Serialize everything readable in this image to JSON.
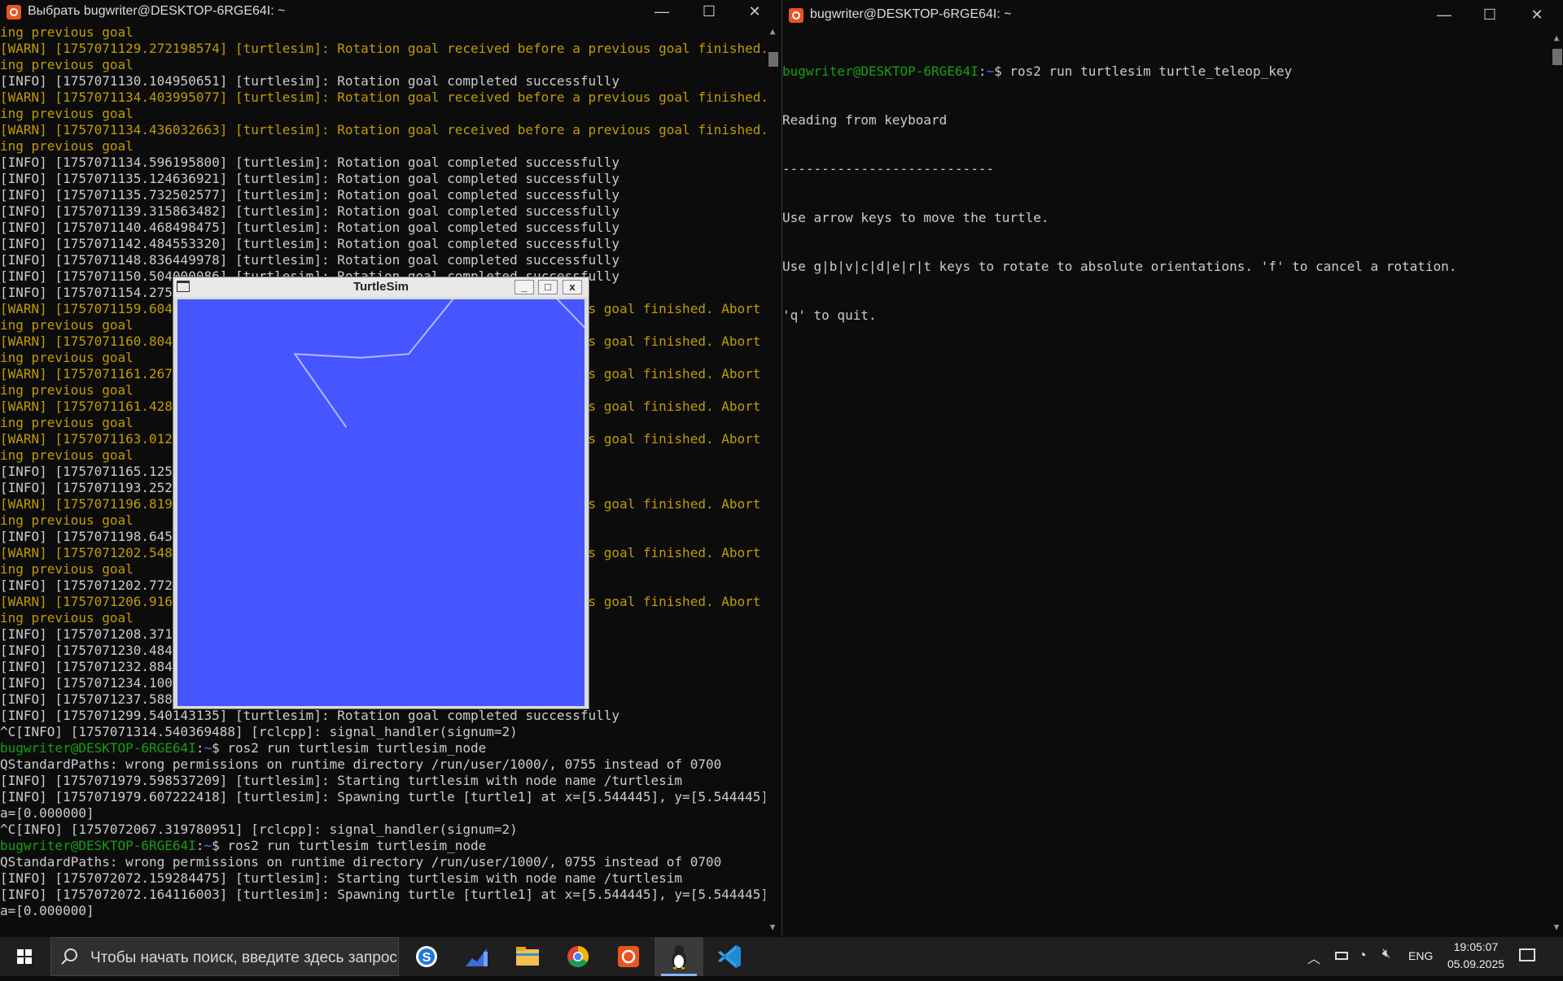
{
  "left_window": {
    "title": "Выбрать bugwriter@DESKTOP-6RGE64I: ~",
    "lines": [
      {
        "t": "ing previous goal",
        "c": "warn"
      },
      {
        "t": "[WARN] [1757071129.272198574] [turtlesim]: Rotation goal received before a previous goal finished. Abort",
        "c": "warn"
      },
      {
        "t": "ing previous goal",
        "c": "warn"
      },
      {
        "t": "[INFO] [1757071130.104950651] [turtlesim]: Rotation goal completed successfully",
        "c": "info"
      },
      {
        "t": "[WARN] [1757071134.403995077] [turtlesim]: Rotation goal received before a previous goal finished. Abort",
        "c": "warn"
      },
      {
        "t": "ing previous goal",
        "c": "warn"
      },
      {
        "t": "[WARN] [1757071134.436032663] [turtlesim]: Rotation goal received before a previous goal finished. Abort",
        "c": "warn"
      },
      {
        "t": "ing previous goal",
        "c": "warn"
      },
      {
        "t": "[INFO] [1757071134.596195800] [turtlesim]: Rotation goal completed successfully",
        "c": "info"
      },
      {
        "t": "[INFO] [1757071135.124636921] [turtlesim]: Rotation goal completed successfully",
        "c": "info"
      },
      {
        "t": "[INFO] [1757071135.732502577] [turtlesim]: Rotation goal completed successfully",
        "c": "info"
      },
      {
        "t": "[INFO] [1757071139.315863482] [turtlesim]: Rotation goal completed successfully",
        "c": "info"
      },
      {
        "t": "[INFO] [1757071140.468498475] [turtlesim]: Rotation goal completed successfully",
        "c": "info"
      },
      {
        "t": "[INFO] [1757071142.484553320] [turtlesim]: Rotation goal completed successfully",
        "c": "info"
      },
      {
        "t": "[INFO] [1757071148.836449978] [turtlesim]: Rotation goal completed successfully",
        "c": "info"
      },
      {
        "t": "[INFO] [1757071150.504000086] [turtlesim]: Rotation goal completed successfully",
        "c": "info"
      },
      {
        "t": "[INFO] [1757071154.27590",
        "c": "info"
      },
      {
        "t": "[WARN] [1757071159.60430                                                 ous goal finished. Abort",
        "c": "warn"
      },
      {
        "t": "ing previous goal",
        "c": "warn"
      },
      {
        "t": "[WARN] [1757071160.80455                                                 ous goal finished. Abort",
        "c": "warn"
      },
      {
        "t": "ing previous goal",
        "c": "warn"
      },
      {
        "t": "[WARN] [1757071161.26785                                                 ous goal finished. Abort",
        "c": "warn"
      },
      {
        "t": "ing previous goal",
        "c": "warn"
      },
      {
        "t": "[WARN] [1757071161.42813                                                 ous goal finished. Abort",
        "c": "warn"
      },
      {
        "t": "ing previous goal",
        "c": "warn"
      },
      {
        "t": "[WARN] [1757071163.01275                                                 ous goal finished. Abort",
        "c": "warn"
      },
      {
        "t": "ing previous goal",
        "c": "warn"
      },
      {
        "t": "[INFO] [1757071165.12555",
        "c": "info"
      },
      {
        "t": "[INFO] [1757071193.25238",
        "c": "info"
      },
      {
        "t": "[WARN] [1757071196.81977                                                 ous goal finished. Abort",
        "c": "warn"
      },
      {
        "t": "ing previous goal",
        "c": "warn"
      },
      {
        "t": "[INFO] [1757071198.64516",
        "c": "info"
      },
      {
        "t": "[WARN] [1757071202.54876                                                 ous goal finished. Abort",
        "c": "warn"
      },
      {
        "t": "ing previous goal",
        "c": "warn"
      },
      {
        "t": "[INFO] [1757071202.77260",
        "c": "info"
      },
      {
        "t": "[WARN] [1757071206.91632                                                 ous goal finished. Abort",
        "c": "warn"
      },
      {
        "t": "ing previous goal",
        "c": "warn"
      },
      {
        "t": "[INFO] [1757071208.37190",
        "c": "info"
      },
      {
        "t": "[INFO] [1757071230.48436",
        "c": "info"
      },
      {
        "t": "[INFO] [1757071232.88441",
        "c": "info"
      },
      {
        "t": "[INFO] [1757071234.10090",
        "c": "info"
      },
      {
        "t": "[INFO] [1757071237.58802",
        "c": "info"
      },
      {
        "t": "[INFO] [1757071299.540143135] [turtlesim]: Rotation goal completed successfully",
        "c": "info"
      },
      {
        "t": "^C[INFO] [1757071314.540369488] [rclcpp]: signal_handler(signum=2)",
        "c": "info"
      },
      {
        "t": "bugwriter@DESKTOP-6RGE64I:~$ ros2 run turtlesim turtlesim_node",
        "c": "prompt",
        "user": "bugwriter@DESKTOP-6RGE64I",
        "path": "~",
        "cmd": "$ ros2 run turtlesim turtlesim_node"
      },
      {
        "t": "QStandardPaths: wrong permissions on runtime directory /run/user/1000/, 0755 instead of 0700",
        "c": "info"
      },
      {
        "t": "[INFO] [1757071979.598537209] [turtlesim]: Starting turtlesim with node name /turtlesim",
        "c": "info"
      },
      {
        "t": "[INFO] [1757071979.607222418] [turtlesim]: Spawning turtle [turtle1] at x=[5.544445], y=[5.544445], thet",
        "c": "info"
      },
      {
        "t": "a=[0.000000]",
        "c": "info"
      },
      {
        "t": "^C[INFO] [1757072067.319780951] [rclcpp]: signal_handler(signum=2)",
        "c": "info"
      },
      {
        "t": "bugwriter@DESKTOP-6RGE64I:~$ ros2 run turtlesim turtlesim_node",
        "c": "prompt",
        "user": "bugwriter@DESKTOP-6RGE64I",
        "path": "~",
        "cmd": "$ ros2 run turtlesim turtlesim_node"
      },
      {
        "t": "QStandardPaths: wrong permissions on runtime directory /run/user/1000/, 0755 instead of 0700",
        "c": "info"
      },
      {
        "t": "[INFO] [1757072072.159284475] [turtlesim]: Starting turtlesim with node name /turtlesim",
        "c": "info"
      },
      {
        "t": "[INFO] [1757072072.164116003] [turtlesim]: Spawning turtle [turtle1] at x=[5.544445], y=[5.544445], thet",
        "c": "info"
      },
      {
        "t": "a=[0.000000]",
        "c": "info"
      }
    ]
  },
  "right_window": {
    "title": "bugwriter@DESKTOP-6RGE64I: ~",
    "prompt_user": "bugwriter@DESKTOP-6RGE64I",
    "prompt_path": "~",
    "prompt_cmd": "$ ros2 run turtlesim turtle_teleop_key",
    "lines": [
      "Reading from keyboard",
      "---------------------------",
      "Use arrow keys to move the turtle.",
      "Use g|b|v|c|d|e|r|t keys to rotate to absolute orientations. 'f' to cancel a rotation.",
      "'q' to quit."
    ]
  },
  "turtlesim": {
    "title": "TurtleSim",
    "background": "#4556ff",
    "path_color": "#b3b8ff",
    "path_points": [
      [
        3.2,
        9.6
      ],
      [
        5.0,
        9.5
      ],
      [
        6.3,
        9.6
      ],
      [
        8.8,
        12.7
      ],
      [
        11.5,
        9.9
      ]
    ],
    "path_start": [
      4.6,
      7.6
    ],
    "turtle_position": [
      11.5,
      10.0
    ]
  },
  "window_buttons": {
    "minimize": "—",
    "maximize": "☐",
    "close": "✕"
  },
  "turtlesim_buttons": {
    "minimize": "_",
    "maximize": "□",
    "close": "x"
  },
  "taskbar": {
    "search_placeholder": "Чтобы начать поиск, введите здесь запрос",
    "apps": [
      "start-icon",
      "skype-icon",
      "stats-icon",
      "file-explorer-icon",
      "chrome-icon",
      "ubuntu-icon",
      "linux-terminal-icon",
      "vscode-icon"
    ],
    "tray": {
      "language": "ENG",
      "time": "19:05:07",
      "date": "05.09.2025"
    }
  },
  "colors": {
    "warn": "#c19c00",
    "info": "#cccccc",
    "prompt_user": "#13a10e",
    "prompt_path": "#3b78ff",
    "ubuntu": "#e95420"
  }
}
